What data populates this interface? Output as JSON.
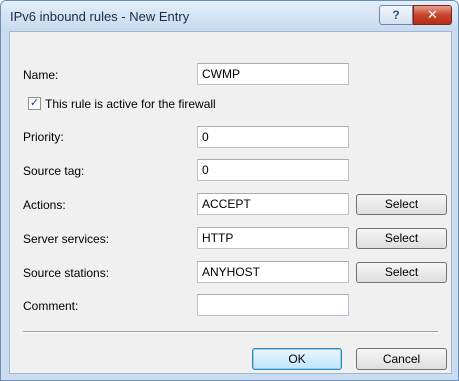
{
  "window": {
    "title": "IPv6 inbound rules - New Entry",
    "help_label": "?",
    "close_label": "✕"
  },
  "form": {
    "name_label": "Name:",
    "name_value": "CWMP",
    "active_checkbox_label": "This rule is active for the firewall",
    "active_checked": true,
    "check_glyph": "✓",
    "priority_label": "Priority:",
    "priority_value": "0",
    "source_tag_label": "Source tag:",
    "source_tag_value": "0",
    "actions_label": "Actions:",
    "actions_value": "ACCEPT",
    "server_services_label": "Server services:",
    "server_services_value": "HTTP",
    "source_stations_label": "Source stations:",
    "source_stations_value": "ANYHOST",
    "comment_label": "Comment:",
    "comment_value": "",
    "select_label": "Select"
  },
  "footer": {
    "ok_label": "OK",
    "cancel_label": "Cancel"
  },
  "colors": {
    "title_bar": "#c9dcf0",
    "close_button": "#c8432b",
    "dialog_background": "#f0f0f0",
    "checkmark": "#1c3f94"
  }
}
